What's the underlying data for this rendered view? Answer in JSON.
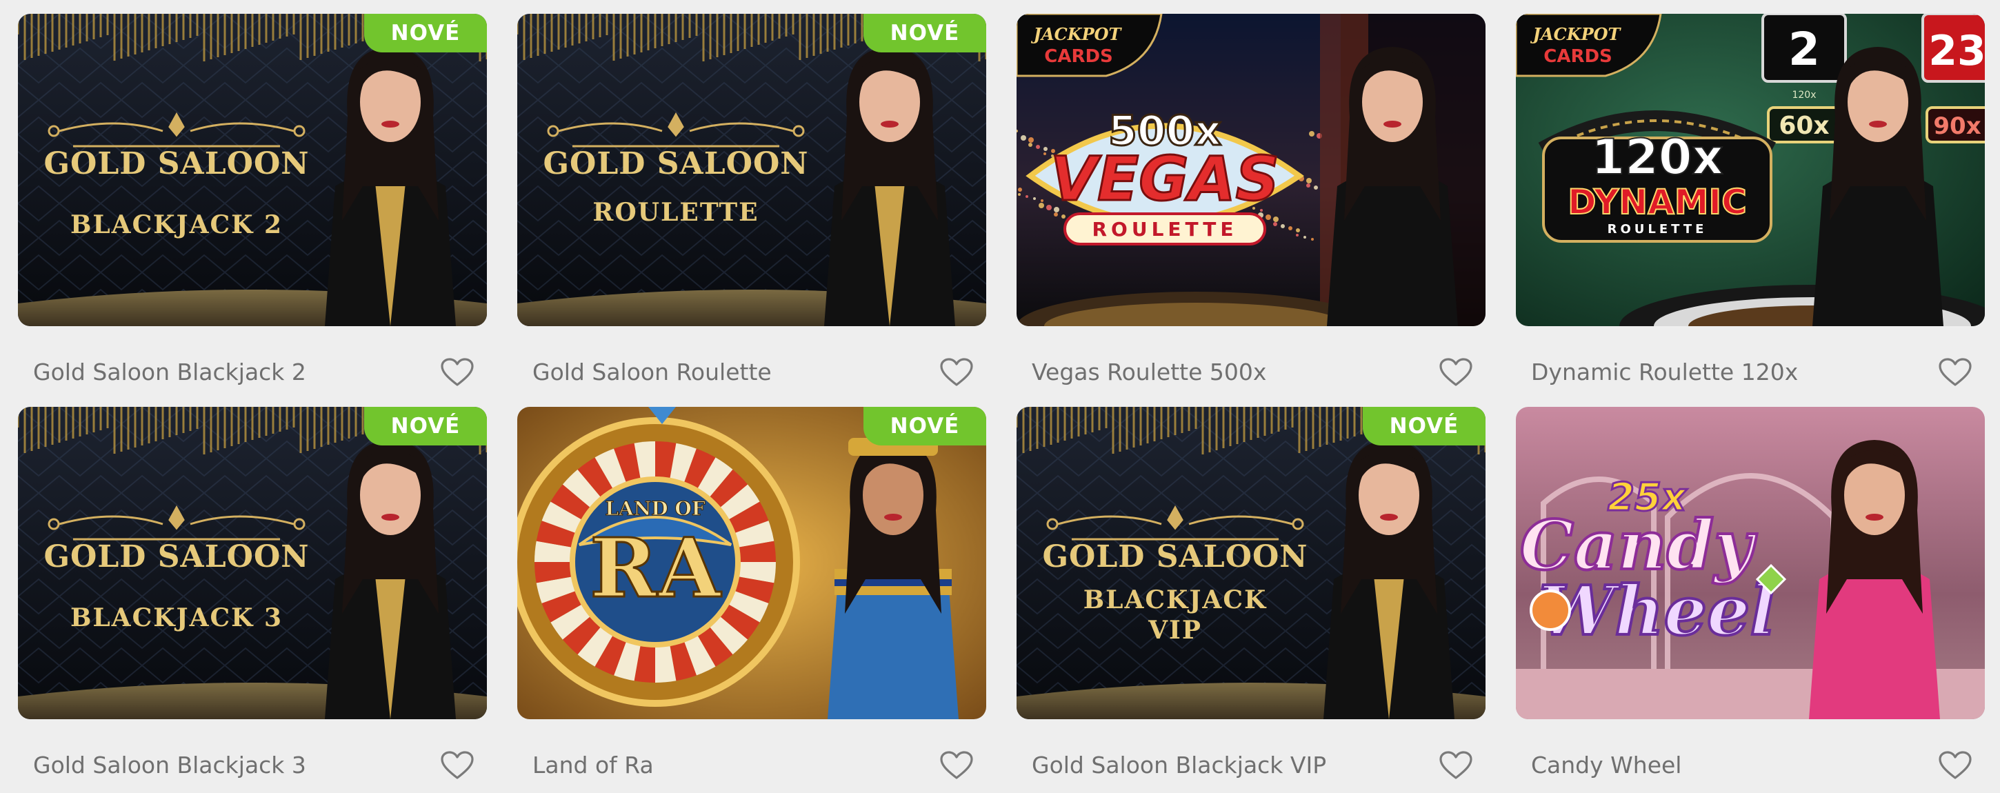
{
  "badge_label": "NOVÉ",
  "colors": {
    "badge_bg": "#72c52d",
    "page_bg": "#eeeeee",
    "title_text": "#6f6f6f",
    "heart_stroke": "#7a7a7a"
  },
  "games": [
    {
      "title": "Gold Saloon Blackjack 2",
      "is_new": true,
      "art": {
        "theme": "gold-saloon",
        "logo": [
          "GOLD SALOON",
          "BLACKJACK 2"
        ],
        "dealer_dress": "black-gold"
      },
      "favorite_icon": "heart-outline-icon"
    },
    {
      "title": "Gold Saloon Roulette",
      "is_new": true,
      "art": {
        "theme": "gold-saloon",
        "logo": [
          "GOLD SALOON",
          "ROULETTE"
        ],
        "dealer_dress": "black-gold"
      },
      "favorite_icon": "heart-outline-icon"
    },
    {
      "title": "Vegas Roulette 500x",
      "is_new": false,
      "art": {
        "theme": "vegas-night",
        "corner_logo": [
          "JACKPOT",
          "CARDS"
        ],
        "logo": [
          "500x",
          "VEGAS",
          "ROULETTE"
        ],
        "dealer_dress": "black"
      },
      "favorite_icon": "heart-outline-icon"
    },
    {
      "title": "Dynamic Roulette 120x",
      "is_new": false,
      "art": {
        "theme": "green-studio",
        "corner_logo": [
          "JACKPOT",
          "CARDS"
        ],
        "logo": [
          "120x",
          "DYNAMIC",
          "ROULETTE"
        ],
        "number_tiles": [
          "2",
          "23"
        ],
        "multipliers": [
          "120x",
          "60x",
          "90x",
          "60x",
          "120x"
        ],
        "dealer_dress": "black"
      },
      "favorite_icon": "heart-outline-icon"
    },
    {
      "title": "Gold Saloon Blackjack 3",
      "is_new": true,
      "art": {
        "theme": "gold-saloon",
        "logo": [
          "GOLD SALOON",
          "BLACKJACK 3"
        ],
        "dealer_dress": "black-gold"
      },
      "favorite_icon": "heart-outline-icon"
    },
    {
      "title": "Land of Ra",
      "is_new": true,
      "art": {
        "theme": "egypt-gold",
        "logo": [
          "LAND OF",
          "RA"
        ],
        "dealer_dress": "blue-egyptian"
      },
      "favorite_icon": "heart-outline-icon"
    },
    {
      "title": "Gold Saloon Blackjack VIP",
      "is_new": true,
      "art": {
        "theme": "gold-saloon",
        "logo": [
          "GOLD SALOON",
          "BLACKJACK",
          "VIP"
        ],
        "dealer_dress": "black-gold"
      },
      "favorite_icon": "heart-outline-icon"
    },
    {
      "title": "Candy Wheel",
      "is_new": false,
      "art": {
        "theme": "candy-pink",
        "logo": [
          "25x",
          "Candy",
          "Wheel"
        ],
        "dealer_dress": "pink"
      },
      "favorite_icon": "heart-outline-icon"
    }
  ]
}
